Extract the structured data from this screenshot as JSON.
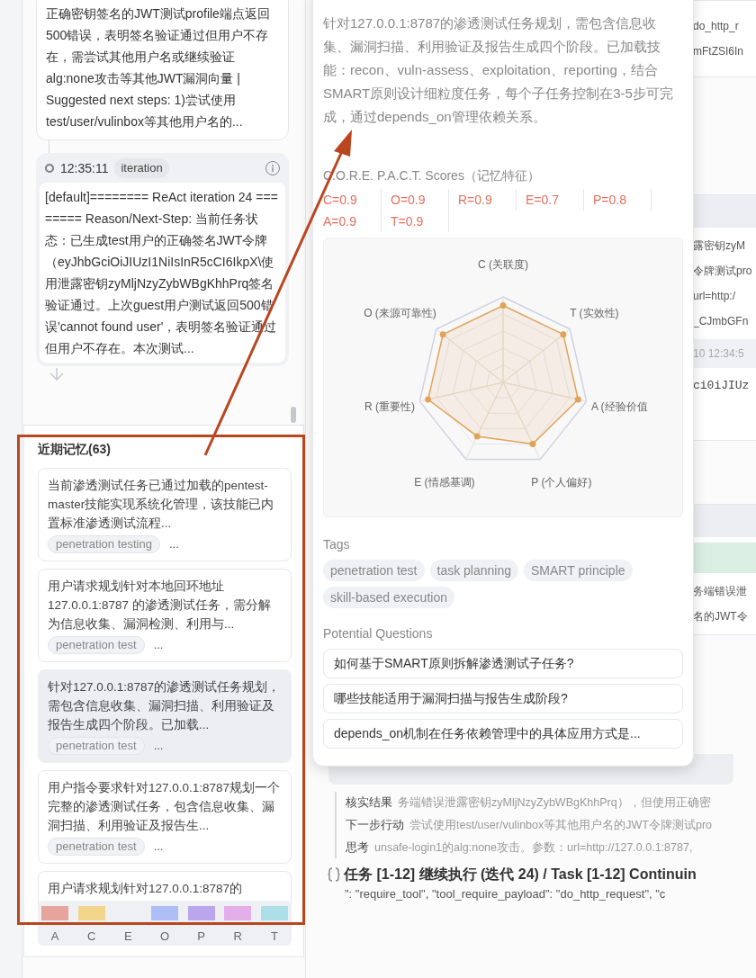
{
  "timeline": {
    "cards": [
      {
        "kind": "plain",
        "text": "正确密钥签名的JWT测试profile端点返回500错误，表明签名验证通过但用户不存在，需尝试其他用户名或继续验证alg:none攻击等其他JWT漏洞向量 | Suggested next steps: 1)尝试使用test/user/vulinbox等其他用户名的..."
      },
      {
        "kind": "event",
        "time": "12:35:11",
        "badge": "iteration",
        "text": "[default]======== ReAct iteration 24 ======== Reason/Next-Step: 当前任务状态：已生成test用户的正确签名JWT令牌（eyJhbGciOiJIUzI1NiIsInR5cCI6IkpX\\使用泄露密钥zyMljNzyZybWBgKhhPrq签名验证通过。上次guest用户测试返回500错误'cannot found user'，表明签名验证通过但用户不存在。本次测试..."
      }
    ]
  },
  "memory_panel": {
    "title": "近期记忆(63)",
    "items": [
      {
        "text": "当前渗透测试任务已通过加载的pentest-master技能实现系统化管理，该技能已内置标准渗透测试流程...",
        "tag": "penetration testing",
        "more": "...",
        "selected": false
      },
      {
        "text": "用户请求规划针对本地回环地址127.0.0.1:8787 的渗透测试任务，需分解为信息收集、漏洞检测、利用与...",
        "tag": "penetration test",
        "more": "...",
        "selected": false
      },
      {
        "text": "针对127.0.0.1:8787的渗透测试任务规划，需包含信息收集、漏洞扫描、利用验证及报告生成四个阶段。已加载...",
        "tag": "penetration test",
        "more": "...",
        "selected": true
      },
      {
        "text": "用户指令要求针对127.0.0.1:8787规划一个完整的渗透测试任务，包含信息收集、漏洞扫描、利用验证及报告生...",
        "tag": "penetration test",
        "more": "...",
        "selected": false
      },
      {
        "text": "用户请求规划针对127.0.0.1:8787的",
        "selected": false
      }
    ],
    "legend": [
      {
        "label": "A",
        "color": "#e6a49c"
      },
      {
        "label": "C",
        "color": "#f1d58a"
      },
      {
        "label": "E"
      },
      {
        "label": "O",
        "color": "#aebef6"
      },
      {
        "label": "P",
        "color": "#bba6ee"
      },
      {
        "label": "R",
        "color": "#e3aeea"
      },
      {
        "label": "T",
        "color": "#addfe8"
      }
    ]
  },
  "popup": {
    "description": "针对127.0.0.1:8787的渗透测试任务规划，需包含信息收集、漏洞扫描、利用验证及报告生成四个阶段。已加载技能：recon、vuln-assess、exploitation、reporting，结合SMART原则设计细粒度任务，每个子任务控制在3-5步可完成，通过depends_on管理依赖关系。",
    "scores_title": "C.O.R.E. P.A.C.T. Scores（记忆特征）",
    "scores": [
      "C=0.9",
      "O=0.9",
      "R=0.9",
      "E=0.7",
      "P=0.8",
      "A=0.9",
      "T=0.9"
    ],
    "radar": {
      "axes": [
        {
          "label": "C (关联度)",
          "level": 0.9
        },
        {
          "label": "T (实效性)",
          "level": 0.9
        },
        {
          "label": "A (经验价值",
          "level": 0.9
        },
        {
          "label": "P (个人偏好)",
          "level": 0.8
        },
        {
          "label": "E (情感基调)",
          "level": 0.7
        },
        {
          "label": "R (重要性)",
          "level": 0.9
        },
        {
          "label": "O (来源可靠性)",
          "level": 0.9
        }
      ]
    },
    "tags_title": "Tags",
    "tags": [
      "penetration test",
      "task planning",
      "SMART principle",
      "skill-based execution"
    ],
    "questions_title": "Potential Questions",
    "questions": [
      "如何基于SMART原则拆解渗透测试子任务?",
      "哪些技能适用于漏洞扫描与报告生成阶段?",
      "depends_on机制在任务依赖管理中的具体应用方式是..."
    ]
  },
  "background": {
    "strip_cards": [
      {
        "kind": "plain",
        "lines": [
          "do_http_r",
          "mFtZSI6In"
        ]
      },
      {
        "kind": "step",
        "lines": [
          "露密钥zyM",
          "令牌测试pro",
          "url=http:/",
          "_CJmbGFn"
        ],
        "stamp": "10 12:34:5",
        "code": "ci0iJIUz"
      },
      {
        "kind": "result",
        "lines": [
          "务端错误泄",
          "名的JWT令"
        ]
      }
    ],
    "verification": [
      {
        "label": "核实结果",
        "value": "务端错误泄露密钥zyMljNzyZybWBgKhhPrq），但使用正确密"
      },
      {
        "label": "下一步行动",
        "value": "尝试使用test/user/vulinbox等其他用户名的JWT令牌测试pro"
      },
      {
        "label": "思考",
        "value": "unsafe-login1的alg:none攻击。参数：url=http://127.0.0.1:8787,"
      }
    ],
    "task_title": "任务 [1-12] 继续执行 (迭代 24) / Task [1-12] Continuin",
    "code_line": "\": \"require_tool\", \"tool_require_payload\": \"do_http_request\", \"c"
  }
}
